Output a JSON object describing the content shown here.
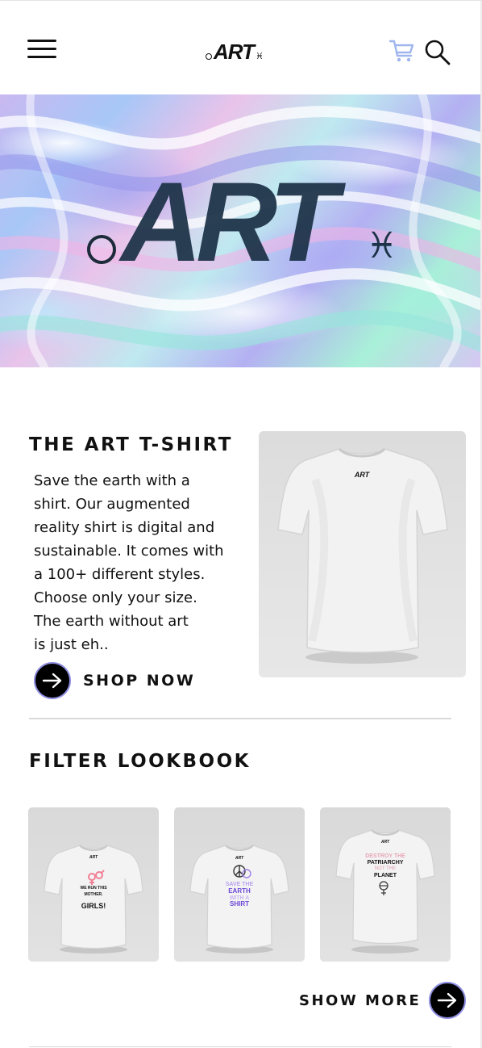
{
  "header": {
    "logo": {
      "word": "ART",
      "symbol": "♓"
    },
    "icons": {
      "menu": "menu-icon",
      "cart": "cart-icon",
      "search": "search-icon"
    },
    "colors": {
      "cart": "#9fb5ee"
    }
  },
  "hero": {
    "logo_word": "ART",
    "logo_symbol": "♓",
    "colors": {
      "logo": "#1c3247"
    }
  },
  "product": {
    "title": "THE ART T-SHIRT",
    "description_lines": [
      "Save the earth with a",
      "shirt. Our augmented",
      "reality shirt is digital and",
      "sustainable. It comes with",
      "a 100+ different styles.",
      "Choose only your size.",
      "The earth without art",
      "is just eh.."
    ],
    "shirt_print": "ART",
    "cta_label": "SHOP NOW"
  },
  "lookbook": {
    "title": "FILTER LOOKBOOK",
    "items": [
      {
        "tag": "ART",
        "lines": [
          "WE RUN THIS",
          "MOTHER.",
          "GIRLS!"
        ]
      },
      {
        "tag": "ART",
        "lines": [
          "SAVE THE",
          "EARTH",
          "WITH A",
          "SHIRT"
        ]
      },
      {
        "tag": "ART",
        "lines": [
          "DESTROY THE",
          "PATRIARCHY",
          "NOT THE",
          "PLANET"
        ]
      }
    ],
    "show_more_label": "SHOW MORE"
  },
  "colors": {
    "accent_ring": "#8f8ee0",
    "text": "#111111",
    "pink": "#f07f95",
    "purple": "#9f7ee8"
  }
}
